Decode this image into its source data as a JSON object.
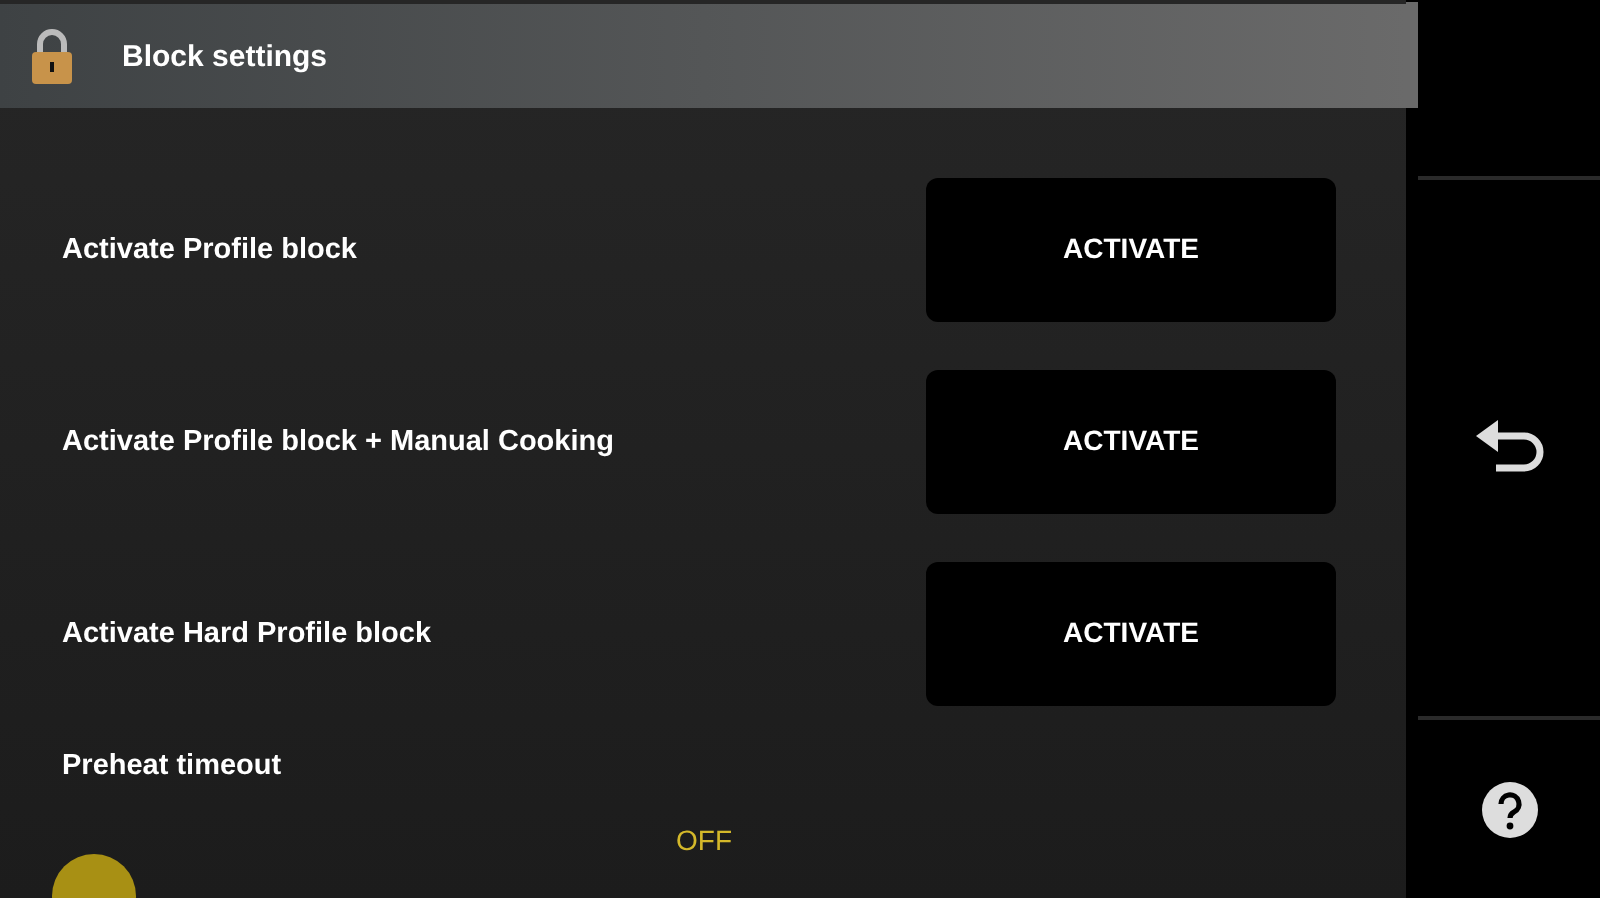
{
  "header": {
    "title": "Block settings"
  },
  "rows": [
    {
      "label": "Activate Profile block",
      "button": "ACTIVATE"
    },
    {
      "label": "Activate Profile block + Manual Cooking",
      "button": "ACTIVATE"
    },
    {
      "label": "Activate Hard Profile block",
      "button": "ACTIVATE"
    }
  ],
  "preheat": {
    "label": "Preheat timeout",
    "reading": "OFF",
    "level": 0
  }
}
